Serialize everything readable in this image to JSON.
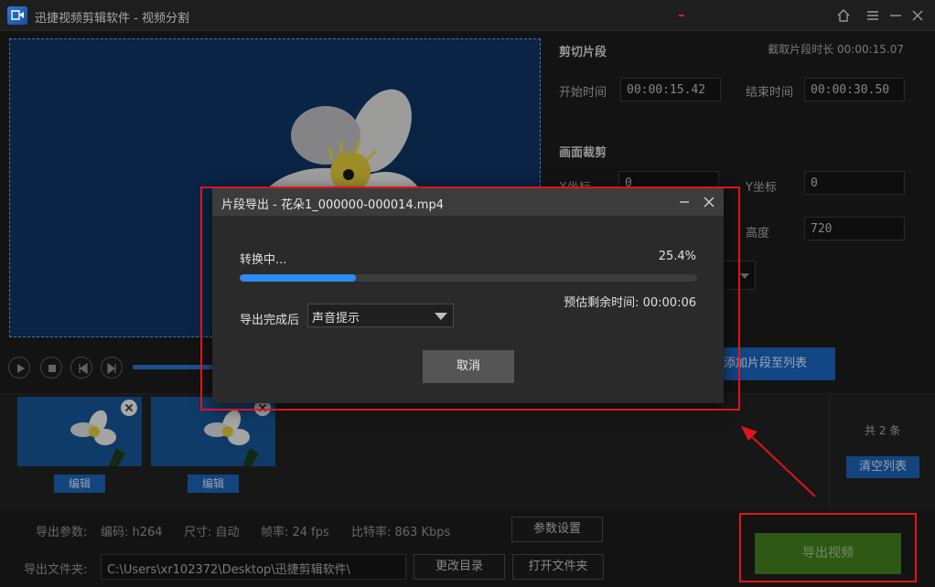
{
  "window": {
    "title": "迅捷视频剪辑软件 - 视频分割",
    "icons": [
      "home-icon",
      "menu-icon",
      "minimize-icon",
      "close-icon"
    ]
  },
  "right_panel": {
    "cut_section": "剪切片段",
    "duration_label": "截取片段时长 00:00:15.07",
    "start_label": "开始时间",
    "start_value": "00:00:15.42",
    "end_label": "结束时间",
    "end_value": "00:00:30.50",
    "crop_section": "画面裁剪",
    "x_label": "X坐标",
    "x_value": "0",
    "y_label": "Y坐标",
    "y_value": "0",
    "height_label": "高度",
    "height_value": "720",
    "add_button": "添加片段至列表"
  },
  "clips": {
    "edit_label": "编辑",
    "count": "共 2 条",
    "clear_button": "清空列表"
  },
  "bottom": {
    "params_label": "导出参数:",
    "codec": "编码: h264",
    "size": "尺寸: 自动",
    "fps": "帧率: 24 fps",
    "bitrate": "比特率: 863 Kbps",
    "param_settings_button": "参数设置",
    "folder_label": "导出文件夹:",
    "folder_path": "C:\\Users\\xr102372\\Desktop\\迅捷剪辑软件\\",
    "change_dir_button": "更改目录",
    "open_folder_button": "打开文件夹",
    "export_button": "导出视频"
  },
  "modal": {
    "title": "片段导出 - 花朵1_000000-000014.mp4",
    "status": "转换中...",
    "percent_text": "25.4%",
    "progress_fraction": 0.254,
    "remaining": "预估剩余时间: 00:00:06",
    "after_label": "导出完成后",
    "after_value": "声音提示",
    "cancel_button": "取消"
  },
  "colors": {
    "accent_blue": "#2d8cf0",
    "export_green": "#3f7a1e",
    "annotation_red": "#e0141b"
  }
}
